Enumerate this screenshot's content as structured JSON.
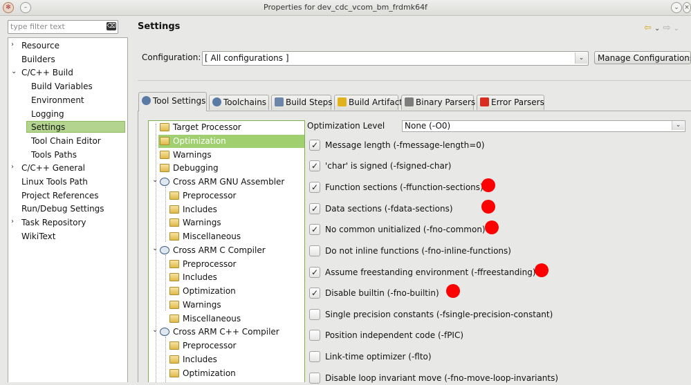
{
  "window": {
    "title": "Properties for dev_cdc_vcom_bm_frdmk64f"
  },
  "filter": {
    "placeholder": "type filter text"
  },
  "left_tree": [
    {
      "label": "Resource",
      "expander": "›"
    },
    {
      "label": "Builders",
      "expander": ""
    },
    {
      "label": "C/C++ Build",
      "expander": "⌄"
    },
    {
      "label": "Build Variables",
      "expander": ""
    },
    {
      "label": "Environment",
      "expander": ""
    },
    {
      "label": "Logging",
      "expander": ""
    },
    {
      "label": "Settings",
      "expander": "",
      "selected": true
    },
    {
      "label": "Tool Chain Editor",
      "expander": ""
    },
    {
      "label": "Tools Paths",
      "expander": ""
    },
    {
      "label": "C/C++ General",
      "expander": "›"
    },
    {
      "label": "Linux Tools Path",
      "expander": ""
    },
    {
      "label": "Project References",
      "expander": ""
    },
    {
      "label": "Run/Debug Settings",
      "expander": ""
    },
    {
      "label": "Task Repository",
      "expander": "›"
    },
    {
      "label": "WikiText",
      "expander": ""
    }
  ],
  "header": {
    "title": "Settings"
  },
  "configuration": {
    "label": "Configuration:",
    "value": "[ All configurations ]",
    "manage_label": "Manage Configurations..."
  },
  "tabs": [
    {
      "label": "Tool Settings",
      "icon": "gear-icon",
      "color": "#5a7aa6",
      "active": true
    },
    {
      "label": "Toolchains",
      "icon": "gear-icon",
      "color": "#5a7aa6"
    },
    {
      "label": "Build Steps",
      "icon": "wrench-icon",
      "color": "#6b86a8"
    },
    {
      "label": "Build Artifact",
      "icon": "trophy-icon",
      "color": "#e2b21c"
    },
    {
      "label": "Binary Parsers",
      "icon": "binary-icon",
      "color": "#7d7d7d"
    },
    {
      "label": "Error Parsers",
      "icon": "error-icon",
      "color": "#d92d20"
    }
  ],
  "tool_tree": [
    {
      "label": "Target Processor",
      "level": 1,
      "icon": "folder"
    },
    {
      "label": "Optimization",
      "level": 1,
      "icon": "folder",
      "selected": true
    },
    {
      "label": "Warnings",
      "level": 1,
      "icon": "folder"
    },
    {
      "label": "Debugging",
      "level": 1,
      "icon": "folder"
    },
    {
      "label": "Cross ARM GNU Assembler",
      "level": 1,
      "icon": "gear",
      "expanded": true
    },
    {
      "label": "Preprocessor",
      "level": 2,
      "icon": "folder"
    },
    {
      "label": "Includes",
      "level": 2,
      "icon": "folder"
    },
    {
      "label": "Warnings",
      "level": 2,
      "icon": "folder"
    },
    {
      "label": "Miscellaneous",
      "level": 2,
      "icon": "folder"
    },
    {
      "label": "Cross ARM C Compiler",
      "level": 1,
      "icon": "gear",
      "expanded": true
    },
    {
      "label": "Preprocessor",
      "level": 2,
      "icon": "folder"
    },
    {
      "label": "Includes",
      "level": 2,
      "icon": "folder"
    },
    {
      "label": "Optimization",
      "level": 2,
      "icon": "folder"
    },
    {
      "label": "Warnings",
      "level": 2,
      "icon": "folder"
    },
    {
      "label": "Miscellaneous",
      "level": 2,
      "icon": "folder"
    },
    {
      "label": "Cross ARM C++ Compiler",
      "level": 1,
      "icon": "gear",
      "expanded": true
    },
    {
      "label": "Preprocessor",
      "level": 2,
      "icon": "folder"
    },
    {
      "label": "Includes",
      "level": 2,
      "icon": "folder"
    },
    {
      "label": "Optimization",
      "level": 2,
      "icon": "folder"
    }
  ],
  "optimization": {
    "level_label": "Optimization Level",
    "level_value": "None (-O0)",
    "options": [
      {
        "label": "Message length (-fmessage-length=0)",
        "checked": true,
        "marked": false
      },
      {
        "label": "'char' is signed (-fsigned-char)",
        "checked": true,
        "marked": false
      },
      {
        "label": "Function sections (-ffunction-sections)",
        "checked": true,
        "marked": true
      },
      {
        "label": "Data sections (-fdata-sections)",
        "checked": true,
        "marked": true
      },
      {
        "label": "No common unitialized (-fno-common)",
        "checked": true,
        "marked": true
      },
      {
        "label": "Do not inline functions (-fno-inline-functions)",
        "checked": false,
        "marked": false
      },
      {
        "label": "Assume freestanding environment (-ffreestanding)",
        "checked": true,
        "marked": true
      },
      {
        "label": "Disable builtin (-fno-builtin)",
        "checked": true,
        "marked": true
      },
      {
        "label": "Single precision constants (-fsingle-precision-constant)",
        "checked": false,
        "marked": false
      },
      {
        "label": "Position independent code (-fPIC)",
        "checked": false,
        "marked": false
      },
      {
        "label": "Link-time optimizer (-flto)",
        "checked": false,
        "marked": false
      },
      {
        "label": "Disable loop invariant move (-fno-move-loop-invariants)",
        "checked": false,
        "marked": false
      }
    ]
  },
  "colors": {
    "annotation_dot": "#ff0000",
    "selection_green": "#9fcf6e"
  }
}
